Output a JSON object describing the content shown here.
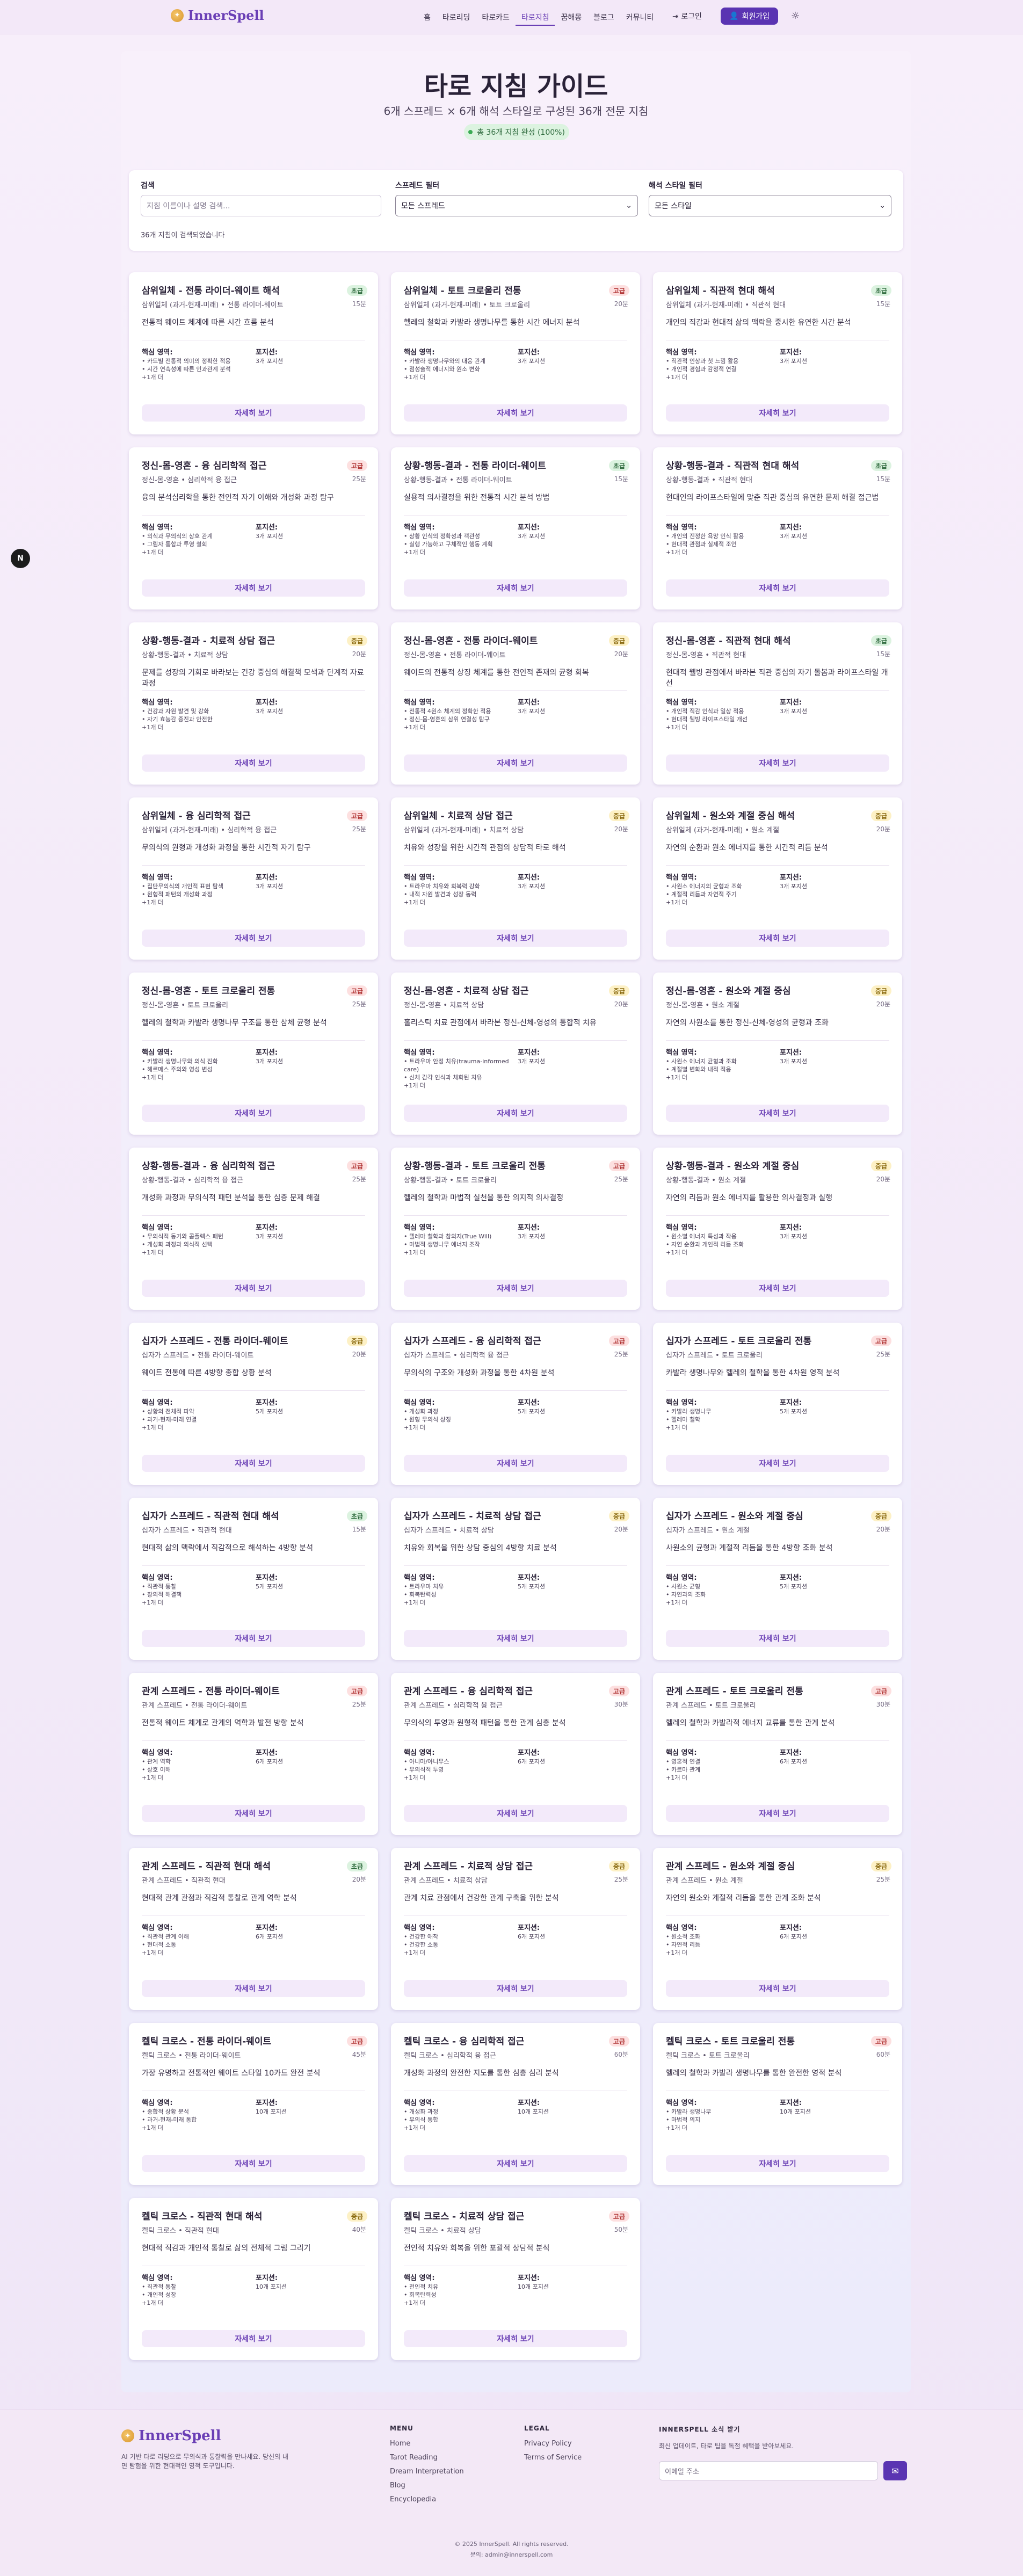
{
  "header": {
    "logo_icon": "sparkle-icon",
    "logo": "InnerSpell",
    "nav": [
      "홈",
      "타로리딩",
      "타로카드",
      "타로지침",
      "꿈해몽",
      "블로그",
      "커뮤니티"
    ],
    "nav_active": 3,
    "login": "로그인",
    "signup": "회원가입",
    "theme_icon": "sun-icon"
  },
  "page": {
    "title": "타로 지침 가이드",
    "subtitle": "6개 스프레드 × 6개 해석 스타일로 구성된 36개 전문 지침",
    "badge": "총 36개 지침 완성 (100%)"
  },
  "filters": {
    "search_label": "검색",
    "search_placeholder": "지침 이름이나 설명 검색...",
    "spread_label": "스프레드 필터",
    "spread_value": "모든 스프레드",
    "style_label": "해석 스타일 필터",
    "style_value": "모든 스타일",
    "count_text": "36개 지침이 검색되었습니다",
    "chevron_icon": "chevron-down-icon"
  },
  "labels": {
    "key_areas": "핵심 영역:",
    "positions": "포지션:",
    "detail": "자세히 보기",
    "more": "+1개 더"
  },
  "cards": [
    {
      "title": "삼위일체 - 전통 라이더-웨이트 해석",
      "spread": "삼위일체 (과거-현재-미래) • 전통 라이더-웨이트",
      "level": "초급",
      "time": "15분",
      "desc": "전통적 웨이트 체계에 따른 시간 흐름 분석",
      "k1": "• 카드별 전통적 의미의 정확한 적용",
      "k2": "• 시간 연속성에 따른 인과관계 분석",
      "pos": "3개 포지션"
    },
    {
      "title": "삼위일체 - 토트 크로울리 전통",
      "spread": "삼위일체 (과거-현재-미래) • 토트 크로울리",
      "level": "고급",
      "time": "20분",
      "desc": "헬레의 철학과 카발라 생명나무를 통한 시간 에너지 분석",
      "k1": "• 카발라 생명나무와의 대응 관계",
      "k2": "• 점성술적 에너지와 원소 변화",
      "pos": "3개 포지션"
    },
    {
      "title": "삼위일체 - 직관적 현대 해석",
      "spread": "삼위일체 (과거-현재-미래) • 직관적 현대",
      "level": "초급",
      "time": "15분",
      "desc": "개인의 직감과 현대적 삶의 맥락을 중시한 유연한 시간 분석",
      "k1": "• 직관적 인상과 첫 느낌 활용",
      "k2": "• 개인적 경험과 감정적 연결",
      "pos": "3개 포지션"
    },
    {
      "title": "정신-몸-영혼 - 융 심리학적 접근",
      "spread": "정신-몸-영혼 • 심리학적 융 접근",
      "level": "고급",
      "time": "25분",
      "desc": "융의 분석심리학을 통한 전인적 자기 이해와 개성화 과정 탐구",
      "k1": "• 의식과 무의식의 상호 관계",
      "k2": "• 그림자 통합과 투영 철회",
      "pos": "3개 포지션"
    },
    {
      "title": "상황-행동-결과 - 전통 라이더-웨이트",
      "spread": "상황-행동-결과 • 전통 라이더-웨이트",
      "level": "초급",
      "time": "15분",
      "desc": "실용적 의사결정을 위한 전통적 시간 분석 방법",
      "k1": "• 상황 인식의 정확성과 객관성",
      "k2": "• 실행 가능하고 구체적인 행동 계획",
      "pos": "3개 포지션"
    },
    {
      "title": "상황-행동-결과 - 직관적 현대 해석",
      "spread": "상황-행동-결과 • 직관적 현대",
      "level": "초급",
      "time": "15분",
      "desc": "현대인의 라이프스타일에 맞춘 직관 중심의 유연한 문제 해결 접근법",
      "k1": "• 개인의 진정한 욕망 인식 활용",
      "k2": "• 현대적 관점과 실제적 조언",
      "pos": "3개 포지션"
    },
    {
      "title": "상황-행동-결과 - 치료적 상담 접근",
      "spread": "상황-행동-결과 • 치료적 상담",
      "level": "중급",
      "time": "20분",
      "desc": "문제를 성장의 기회로 바라보는 건강 중심의 해결책 모색과 단계적 자료 과정",
      "k1": "• 건강과 자원 발견 및 강화",
      "k2": "• 자기 효능감 증진과 안전한",
      "pos": "3개 포지션"
    },
    {
      "title": "정신-몸-영혼 - 전통 라이더-웨이트",
      "spread": "정신-몸-영혼 • 전통 라이더-웨이트",
      "level": "중급",
      "time": "20분",
      "desc": "웨이트의 전통적 상징 체계를 통한 전인적 존재의 균형 회복",
      "k1": "• 전통적 4원소 체계의 정확한 적용",
      "k2": "• 정신-몸-영혼의 삼위 연결성 탐구",
      "pos": "3개 포지션"
    },
    {
      "title": "정신-몸-영혼 - 직관적 현대 해석",
      "spread": "정신-몸-영혼 • 직관적 현대",
      "level": "초급",
      "time": "15분",
      "desc": "현대적 웰빙 관점에서 바라본 직관 중심의 자기 돌봄과 라이프스타일 개선",
      "k1": "• 개인적 직감 인식과 일상 적용",
      "k2": "• 현대적 웰빙 라이프스타일 개선",
      "pos": "3개 포지션"
    },
    {
      "title": "삼위일체 - 융 심리학적 접근",
      "spread": "삼위일체 (과거-현재-미래) • 심리학적 융 접근",
      "level": "고급",
      "time": "25분",
      "desc": "무의식의 원형과 개성화 과정을 통한 시간적 자기 탐구",
      "k1": "• 집단무의식의 개인적 표현 탐색",
      "k2": "• 원형적 패턴의 개성화 과정",
      "pos": "3개 포지션"
    },
    {
      "title": "삼위일체 - 치료적 상담 접근",
      "spread": "삼위일체 (과거-현재-미래) • 치료적 상담",
      "level": "중급",
      "time": "20분",
      "desc": "치유와 성장을 위한 시간적 관점의 상담적 타로 해석",
      "k1": "• 트라우마 치유와 회복력 강화",
      "k2": "• 내적 자원 발견과 성장 동력",
      "pos": "3개 포지션"
    },
    {
      "title": "삼위일체 - 원소와 계절 중심 해석",
      "spread": "삼위일체 (과거-현재-미래) • 원소 계절",
      "level": "중급",
      "time": "20분",
      "desc": "자연의 순환과 원소 에너지를 통한 시간적 리듬 분석",
      "k1": "• 사원소 에너지의 균형과 조화",
      "k2": "• 계절적 리듬과 자연적 주기",
      "pos": "3개 포지션"
    },
    {
      "title": "정신-몸-영혼 - 토트 크로울리 전통",
      "spread": "정신-몸-영혼 • 토트 크로울리",
      "level": "고급",
      "time": "25분",
      "desc": "헬레의 철학과 카발라 생명나무 구조를 통한 삼체 균형 분석",
      "k1": "• 카발라 생명나무와 의식 진화",
      "k2": "• 헤르메스 주의와 영성 변성",
      "pos": "3개 포지션"
    },
    {
      "title": "정신-몸-영혼 - 치료적 상담 접근",
      "spread": "정신-몸-영혼 • 치료적 상담",
      "level": "중급",
      "time": "20분",
      "desc": "홀리스틱 치료 관점에서 바라본 정신-신체-영성의 통합적 치유",
      "k1": "• 트라우마 안정 치유(trauma-informed care)",
      "k2": "• 신체 감각 인식과 체화된 치유",
      "pos": "3개 포지션"
    },
    {
      "title": "정신-몸-영혼 - 원소와 계절 중심",
      "spread": "정신-몸-영혼 • 원소 계절",
      "level": "중급",
      "time": "20분",
      "desc": "자연의 사원소를 통한 정신-신체-영성의 균형과 조화",
      "k1": "• 사원소 에너지 균형과 조화",
      "k2": "• 계절별 변화와 내적 적응",
      "pos": "3개 포지션"
    },
    {
      "title": "상황-행동-결과 - 융 심리학적 접근",
      "spread": "상황-행동-결과 • 심리학적 융 접근",
      "level": "고급",
      "time": "25분",
      "desc": "개성화 과정과 무의식적 패턴 분석을 통한 심층 문제 해결",
      "k1": "• 무의식적 동기와 콤플렉스 패턴",
      "k2": "• 개성화 과정과 의식적 선택",
      "pos": "3개 포지션"
    },
    {
      "title": "상황-행동-결과 - 토트 크로울리 전통",
      "spread": "상황-행동-결과 • 토트 크로울리",
      "level": "고급",
      "time": "25분",
      "desc": "헬레의 철학과 마법적 실천을 통한 의지적 의사결정",
      "k1": "• 텔레마 철학과 참의지(True Will)",
      "k2": "• 마법적 생명나무 에너지 조작",
      "pos": "3개 포지션"
    },
    {
      "title": "상황-행동-결과 - 원소와 계절 중심",
      "spread": "상황-행동-결과 • 원소 계절",
      "level": "중급",
      "time": "20분",
      "desc": "자연의 리듬과 원소 에너지를 활용한 의사결정과 실행",
      "k1": "• 원소별 에너지 특성과 작용",
      "k2": "• 자연 순환과 개인적 리듬 조화",
      "pos": "3개 포지션"
    },
    {
      "title": "십자가 스프레드 - 전통 라이더-웨이트",
      "spread": "십자가 스프레드 • 전통 라이더-웨이트",
      "level": "중급",
      "time": "20분",
      "desc": "웨이트 전통에 따른 4방향 종합 상황 분석",
      "k1": "• 상황의 전체적 파악",
      "k2": "• 과거-현재-미래 연결",
      "pos": "5개 포지션"
    },
    {
      "title": "십자가 스프레드 - 융 심리학적 접근",
      "spread": "십자가 스프레드 • 심리학적 융 접근",
      "level": "고급",
      "time": "25분",
      "desc": "무의식의 구조와 개성화 과정을 통한 4차원 분석",
      "k1": "• 개성화 과정",
      "k2": "• 원형 무의식 상징",
      "pos": "5개 포지션"
    },
    {
      "title": "십자가 스프레드 - 토트 크로울리 전통",
      "spread": "십자가 스프레드 • 토트 크로울리",
      "level": "고급",
      "time": "25분",
      "desc": "카발라 생명나무와 헬레의 철학을 통한 4차원 영적 분석",
      "k1": "• 카발라 생명나무",
      "k2": "• 헬레마 철학",
      "pos": "5개 포지션"
    },
    {
      "title": "십자가 스프레드 - 직관적 현대 해석",
      "spread": "십자가 스프레드 • 직관적 현대",
      "level": "초급",
      "time": "15분",
      "desc": "현대적 삶의 맥락에서 직감적으로 해석하는 4방향 분석",
      "k1": "• 직관적 통찰",
      "k2": "• 창의적 해결책",
      "pos": "5개 포지션"
    },
    {
      "title": "십자가 스프레드 - 치료적 상담 접근",
      "spread": "십자가 스프레드 • 치료적 상담",
      "level": "중급",
      "time": "20분",
      "desc": "치유와 회복을 위한 상담 중심의 4방향 치료 분석",
      "k1": "• 트라우마 치유",
      "k2": "• 회복탄력성",
      "pos": "5개 포지션"
    },
    {
      "title": "십자가 스프레드 - 원소와 계절 중심",
      "spread": "십자가 스프레드 • 원소 계절",
      "level": "중급",
      "time": "20분",
      "desc": "사원소의 균형과 계절적 리듬을 통한 4방향 조화 분석",
      "k1": "• 사원소 균형",
      "k2": "• 자연과의 조화",
      "pos": "5개 포지션"
    },
    {
      "title": "관계 스프레드 - 전통 라이더-웨이트",
      "spread": "관계 스프레드 • 전통 라이더-웨이트",
      "level": "고급",
      "time": "25분",
      "desc": "전통적 웨이트 체계로 관계의 역학과 발전 방향 분석",
      "k1": "• 관계 역학",
      "k2": "• 상호 이해",
      "pos": "6개 포지션"
    },
    {
      "title": "관계 스프레드 - 융 심리학적 접근",
      "spread": "관계 스프레드 • 심리학적 융 접근",
      "level": "고급",
      "time": "30분",
      "desc": "무의식의 투영과 원형적 패턴을 통한 관계 심층 분석",
      "k1": "• 아니마/아니무스",
      "k2": "• 무의식적 투영",
      "pos": "6개 포지션"
    },
    {
      "title": "관계 스프레드 - 토트 크로울리 전통",
      "spread": "관계 스프레드 • 토트 크로울리",
      "level": "고급",
      "time": "30분",
      "desc": "헬레의 철학과 카발라적 에너지 교류를 통한 관계 분석",
      "k1": "• 영혼적 연결",
      "k2": "• 카르마 관계",
      "pos": "6개 포지션"
    },
    {
      "title": "관계 스프레드 - 직관적 현대 해석",
      "spread": "관계 스프레드 • 직관적 현대",
      "level": "초급",
      "time": "20분",
      "desc": "현대적 관계 관점과 직감적 통찰로 관계 역학 분석",
      "k1": "• 직관적 관계 이해",
      "k2": "• 현대적 소통",
      "pos": "6개 포지션"
    },
    {
      "title": "관계 스프레드 - 치료적 상담 접근",
      "spread": "관계 스프레드 • 치료적 상담",
      "level": "중급",
      "time": "25분",
      "desc": "관계 치료 관점에서 건강한 관계 구축을 위한 분석",
      "k1": "• 건강한 애착",
      "k2": "• 건강한 소통",
      "pos": "6개 포지션"
    },
    {
      "title": "관계 스프레드 - 원소와 계절 중심",
      "spread": "관계 스프레드 • 원소 계절",
      "level": "중급",
      "time": "25분",
      "desc": "자연의 원소와 계절적 리듬을 통한 관계 조화 분석",
      "k1": "• 원소적 조화",
      "k2": "• 자연적 리듬",
      "pos": "6개 포지션"
    },
    {
      "title": "켈틱 크로스 - 전통 라이더-웨이트",
      "spread": "켈틱 크로스 • 전통 라이더-웨이트",
      "level": "고급",
      "time": "45분",
      "desc": "가장 유명하고 전통적인 웨이트 스타일 10카드 완전 분석",
      "k1": "• 종합적 상황 분석",
      "k2": "• 과거-현재-미래 통합",
      "pos": "10개 포지션"
    },
    {
      "title": "켈틱 크로스 - 융 심리학적 접근",
      "spread": "켈틱 크로스 • 심리학적 융 접근",
      "level": "고급",
      "time": "60분",
      "desc": "개성화 과정의 완전한 지도를 통한 심층 심리 분석",
      "k1": "• 개성화 과정",
      "k2": "• 무의식 통합",
      "pos": "10개 포지션"
    },
    {
      "title": "켈틱 크로스 - 토트 크로울리 전통",
      "spread": "켈틱 크로스 • 토트 크로울리",
      "level": "고급",
      "time": "60분",
      "desc": "헬레의 철학과 카발라 생명나무를 통한 완전한 영적 분석",
      "k1": "• 카발라 생명나무",
      "k2": "• 마법적 의지",
      "pos": "10개 포지션"
    },
    {
      "title": "켈틱 크로스 - 직관적 현대 해석",
      "spread": "켈틱 크로스 • 직관적 현대",
      "level": "중급",
      "time": "40분",
      "desc": "현대적 직감과 개인적 통찰로 삶의 전체적 그림 그리기",
      "k1": "• 직관적 통찰",
      "k2": "• 개인적 성장",
      "pos": "10개 포지션"
    },
    {
      "title": "켈틱 크로스 - 치료적 상담 접근",
      "spread": "켈틱 크로스 • 치료적 상담",
      "level": "고급",
      "time": "50분",
      "desc": "전인적 치유와 회복을 위한 포괄적 상담적 분석",
      "k1": "• 전인적 치유",
      "k2": "• 회복탄력성",
      "pos": "10개 포지션"
    }
  ],
  "footer": {
    "logo": "InnerSpell",
    "desc": "AI 기반 타로 리딩으로 무의식과 통찰력을 만나세요. 당신의 내면 탐험을 위한 현대적인 영적 도구입니다.",
    "menu_title": "MENU",
    "menu": [
      "Home",
      "Tarot Reading",
      "Dream Interpretation",
      "Blog",
      "Encyclopedia"
    ],
    "legal_title": "LEGAL",
    "legal": [
      "Privacy Policy",
      "Terms of Service"
    ],
    "news_title": "INNERSPELL 소식 받기",
    "news_desc": "최신 업데이트, 타로 팁을 독점 혜택을 받아보세요.",
    "news_placeholder": "이메일 주소",
    "news_icon": "send-icon",
    "copyright": "© 2025 InnerSpell. All rights reserved.",
    "contact": "문의: admin@innerspell.com"
  }
}
